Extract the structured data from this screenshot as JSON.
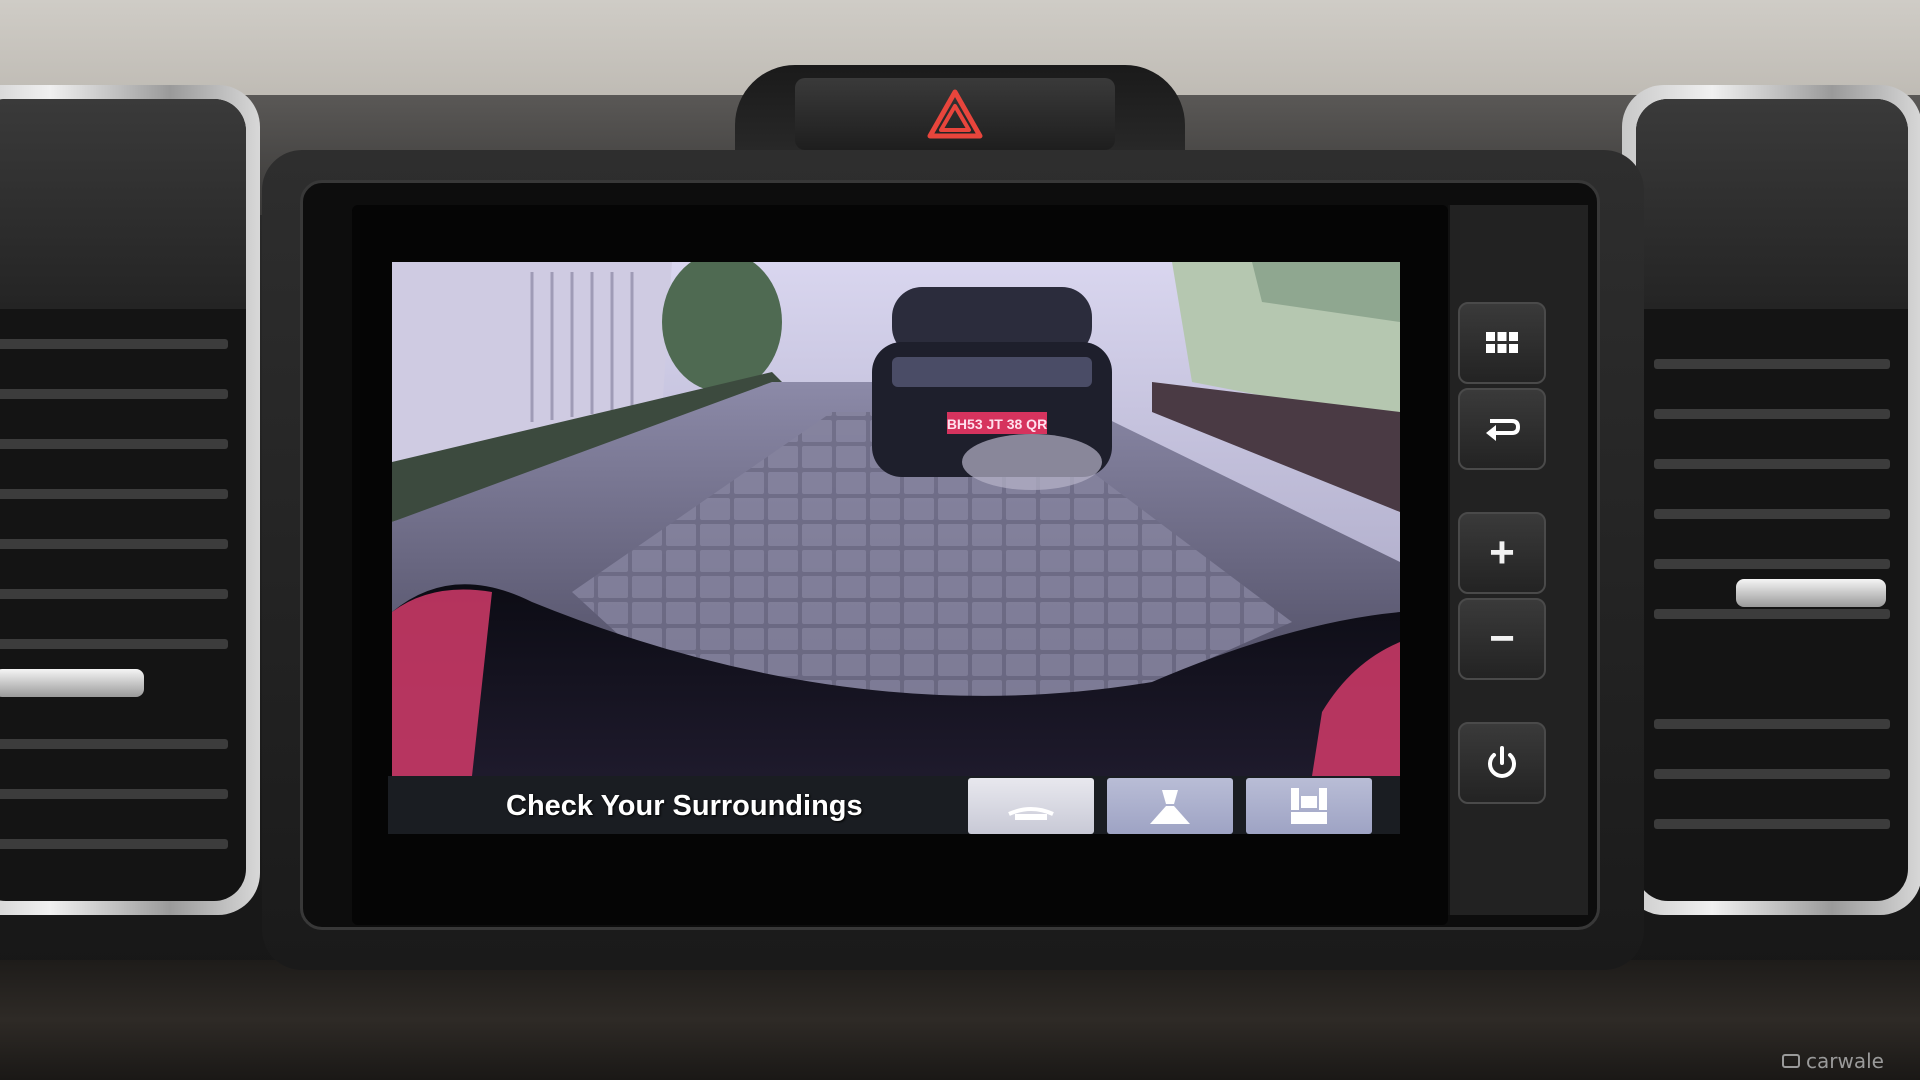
{
  "camera_screen": {
    "message": "Check Your Surroundings",
    "view_modes": [
      {
        "icon": "normal-view-icon",
        "selected": true
      },
      {
        "icon": "wide-view-icon",
        "selected": false
      },
      {
        "icon": "top-down-view-icon",
        "selected": false
      }
    ],
    "licence_plate": "BH53 JT 38 QR"
  },
  "hard_keys": [
    {
      "icon": "apps-grid-icon"
    },
    {
      "icon": "back-arrow-icon"
    },
    {
      "icon": "volume-up-icon",
      "glyph": "+"
    },
    {
      "icon": "volume-down-icon",
      "glyph": "−"
    },
    {
      "icon": "power-icon"
    }
  ],
  "hazard": {
    "icon": "hazard-triangle-icon",
    "color": "#e8453c"
  },
  "watermark": "carwale"
}
